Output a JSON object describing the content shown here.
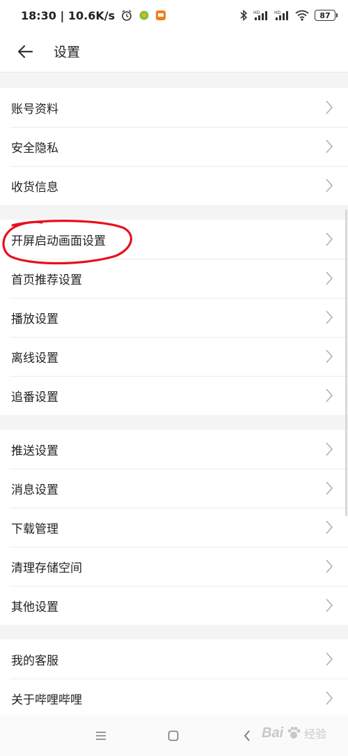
{
  "status_bar": {
    "time_speed": "18:30 | 10.6K/s",
    "battery": "87",
    "icons": [
      "alarm-icon",
      "app-notification-icon",
      "app-notification-icon",
      "bluetooth-icon",
      "signal-icon",
      "signal-icon",
      "wifi-icon",
      "battery-icon"
    ]
  },
  "header": {
    "title": "设置",
    "back_icon": "back-arrow-icon"
  },
  "groups": [
    {
      "items": [
        "账号资料",
        "安全隐私",
        "收货信息"
      ]
    },
    {
      "items": [
        "开屏启动画面设置",
        "首页推荐设置",
        "播放设置",
        "离线设置",
        "追番设置"
      ]
    },
    {
      "items": [
        "推送设置",
        "消息设置",
        "下载管理",
        "清理存储空间",
        "其他设置"
      ]
    },
    {
      "items": [
        "我的客服",
        "关于哔哩哔哩"
      ]
    }
  ],
  "annotation": {
    "highlighted_item": "开屏启动画面设置",
    "color": "#e8101c"
  },
  "nav_bar": [
    "menu-icon",
    "home-icon",
    "back-icon"
  ],
  "watermark": {
    "logo_text": "Bai",
    "text": "经验",
    "icon": "paw-icon"
  },
  "colors": {
    "background": "#f4f4f4",
    "card": "#ffffff",
    "divider": "#ececec",
    "chevron": "#b0b0b0"
  }
}
